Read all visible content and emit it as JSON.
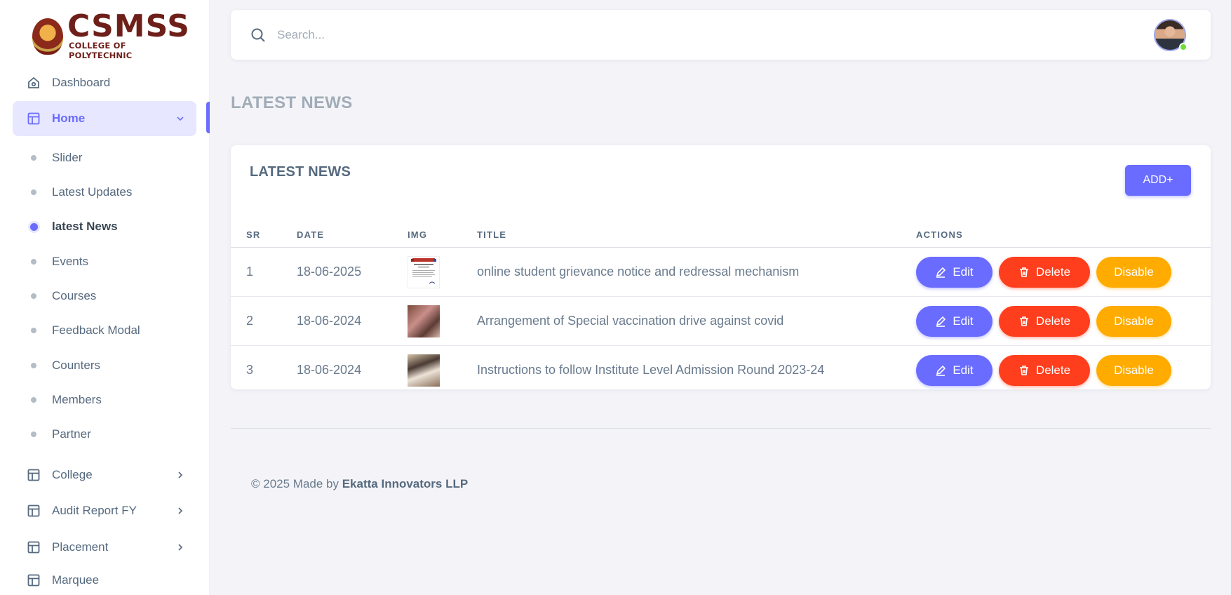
{
  "brand": {
    "title": "CSMSS",
    "subtitle": "COLLEGE OF POLYTECHNIC"
  },
  "sidebar": {
    "items": [
      {
        "label": "Dashboard",
        "icon": "home-icon"
      },
      {
        "label": "Home",
        "icon": "layout-icon",
        "expanded": true
      },
      {
        "label": "College",
        "icon": "layout-icon"
      },
      {
        "label": "Audit Report FY",
        "icon": "layout-icon"
      },
      {
        "label": "Placement",
        "icon": "layout-icon"
      },
      {
        "label": "Marquee",
        "icon": "layout-icon"
      }
    ],
    "subitems": [
      "Slider",
      "Latest Updates",
      "latest News",
      "Events",
      "Courses",
      "Feedback Modal",
      "Counters",
      "Members",
      "Partner"
    ],
    "current_subitem": "latest News"
  },
  "navbar": {
    "search_placeholder": "Search...",
    "user_status": "online"
  },
  "page": {
    "heading": "LATEST NEWS"
  },
  "card": {
    "title": "LATEST NEWS",
    "add_label": "ADD+"
  },
  "table": {
    "headers": {
      "sr": "SR",
      "date": "DATE",
      "img": "IMG",
      "title": "TITLE",
      "actions": "ACTIONS"
    },
    "rows": [
      {
        "sr": "1",
        "date": "18-06-2025",
        "title": "online student grievance notice and redressal mechanism",
        "img": "document-thumbnail"
      },
      {
        "sr": "2",
        "date": "18-06-2024",
        "title": "Arrangement of Special vaccination drive against covid",
        "img": "photo-thumbnail"
      },
      {
        "sr": "3",
        "date": "18-06-2024",
        "title": "Instructions to follow Institute Level Admission Round 2023-24",
        "img": "photo-thumbnail"
      }
    ],
    "actions": {
      "edit": "Edit",
      "delete": "Delete",
      "disable": "Disable"
    }
  },
  "footer": {
    "prefix": "© 2025 Made by ",
    "company": "Ekatta Innovators LLP"
  },
  "colors": {
    "primary": "#696cff",
    "danger": "#ff3e1d",
    "warning": "#ffab00",
    "brand": "#6e1f1a"
  }
}
